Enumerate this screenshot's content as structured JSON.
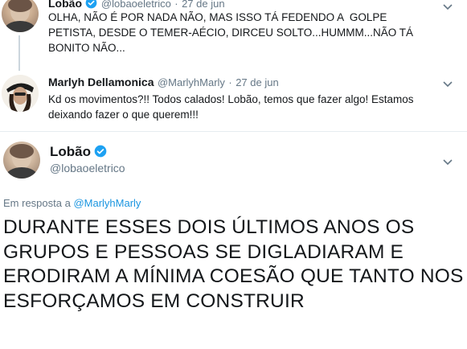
{
  "tweet1": {
    "name": "Lobão",
    "handle": "@lobaoeletrico",
    "separator": "·",
    "date": "27 de jun",
    "text": "OLHA, NÃO É POR NADA NÃO, MAS ISSO TÁ FEDENDO A  GOLPE PETISTA, DESDE O TEMER-AÉCIO, DIRCEU SOLTO...HUMMM...NÃO TÁ BONITO NÃO..."
  },
  "tweet2": {
    "name": "Marlyh Dellamonica",
    "handle": "@MarlyhMarly",
    "separator": "·",
    "date": "27 de jun",
    "text": "Kd os movimentos?!! Todos calados! Lobão, temos que fazer algo! Estamos deixando fazer o que querem!!!"
  },
  "main_tweet": {
    "name": "Lobão",
    "handle": "@lobaoeletrico",
    "reply_prefix": "Em resposta a",
    "reply_handle": "@MarlyhMarly",
    "text": "DURANTE ESSES DOIS ÚLTIMOS ANOS OS GRUPOS E PESSOAS SE DIGLADIARAM E ERODIRAM A MÍNIMA COESÃO QUE TANTO NOS ESFORÇAMOS EM CONSTRUIR"
  },
  "colors": {
    "verified": "#1da1f2",
    "link": "#1b95e0",
    "muted": "#657786"
  },
  "icons": [
    "verified-badge-icon",
    "chevron-down-icon"
  ]
}
